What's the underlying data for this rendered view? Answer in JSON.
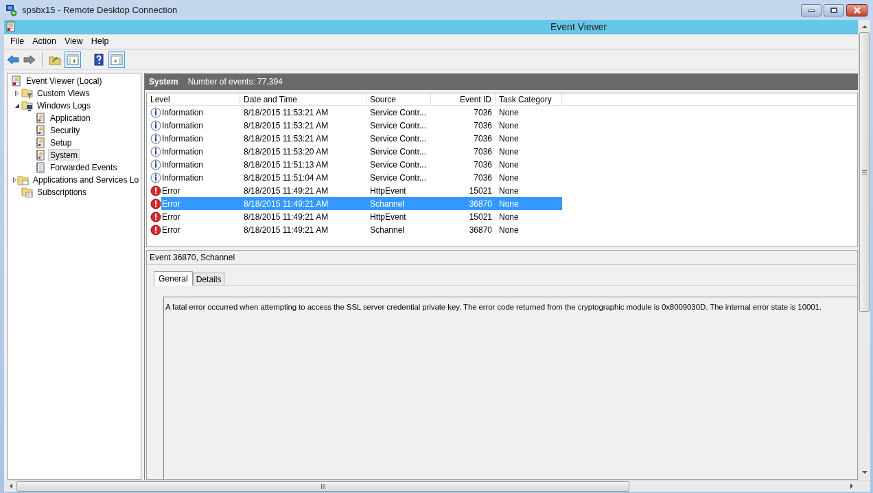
{
  "window": {
    "title": "spsbx15 - Remote Desktop Connection"
  },
  "app": {
    "title": "Event Viewer"
  },
  "menu": [
    "File",
    "Action",
    "View",
    "Help"
  ],
  "tree": [
    {
      "label": "Event Viewer (Local)",
      "kind": "root",
      "selected": false,
      "children": [
        {
          "label": "Custom Views",
          "kind": "filter-folder",
          "expanded": false,
          "selected": false
        },
        {
          "label": "Windows Logs",
          "kind": "computer-folder",
          "expanded": true,
          "selected": false,
          "children": [
            {
              "label": "Application",
              "kind": "log",
              "selected": false
            },
            {
              "label": "Security",
              "kind": "log",
              "selected": false
            },
            {
              "label": "Setup",
              "kind": "log",
              "selected": false
            },
            {
              "label": "System",
              "kind": "log",
              "selected": true
            },
            {
              "label": "Forwarded Events",
              "kind": "plain-log",
              "selected": false
            }
          ]
        },
        {
          "label": "Applications and Services Lo",
          "kind": "folder",
          "expanded": false,
          "selected": false
        },
        {
          "label": "Subscriptions",
          "kind": "subscriptions",
          "selected": false
        }
      ]
    }
  ],
  "log_header": {
    "name": "System",
    "count": "Number of events: 77,394"
  },
  "table": {
    "columns": [
      "Level",
      "Date and Time",
      "Source",
      "Event ID",
      "Task Category"
    ],
    "rows": [
      {
        "kind": "information",
        "level": "Information",
        "date": "8/18/2015 11:53:21 AM",
        "source": "Service Contr...",
        "event_id": "7036",
        "category": "None",
        "selected": false
      },
      {
        "kind": "information",
        "level": "Information",
        "date": "8/18/2015 11:53:21 AM",
        "source": "Service Contr...",
        "event_id": "7036",
        "category": "None",
        "selected": false
      },
      {
        "kind": "information",
        "level": "Information",
        "date": "8/18/2015 11:53:21 AM",
        "source": "Service Contr...",
        "event_id": "7036",
        "category": "None",
        "selected": false
      },
      {
        "kind": "information",
        "level": "Information",
        "date": "8/18/2015 11:53:20 AM",
        "source": "Service Contr...",
        "event_id": "7036",
        "category": "None",
        "selected": false
      },
      {
        "kind": "information",
        "level": "Information",
        "date": "8/18/2015 11:51:13 AM",
        "source": "Service Contr...",
        "event_id": "7036",
        "category": "None",
        "selected": false
      },
      {
        "kind": "information",
        "level": "Information",
        "date": "8/18/2015 11:51:04 AM",
        "source": "Service Contr...",
        "event_id": "7036",
        "category": "None",
        "selected": false
      },
      {
        "kind": "error",
        "level": "Error",
        "date": "8/18/2015 11:49:21 AM",
        "source": "HttpEvent",
        "event_id": "15021",
        "category": "None",
        "selected": false
      },
      {
        "kind": "error",
        "level": "Error",
        "date": "8/18/2015 11:49:21 AM",
        "source": "Schannel",
        "event_id": "36870",
        "category": "None",
        "selected": true
      },
      {
        "kind": "error",
        "level": "Error",
        "date": "8/18/2015 11:49:21 AM",
        "source": "HttpEvent",
        "event_id": "15021",
        "category": "None",
        "selected": false
      },
      {
        "kind": "error",
        "level": "Error",
        "date": "8/18/2015 11:49:21 AM",
        "source": "Schannel",
        "event_id": "36870",
        "category": "None",
        "selected": false
      }
    ]
  },
  "detail": {
    "title": "Event 36870, Schannel",
    "tabs": [
      {
        "label": "General",
        "selected": true
      },
      {
        "label": "Details",
        "selected": false
      }
    ],
    "message": "A fatal error occurred when attempting to access the SSL server credential private key. The error code returned from the cryptographic module is 0x8009030D. The internal error state is 10001."
  }
}
